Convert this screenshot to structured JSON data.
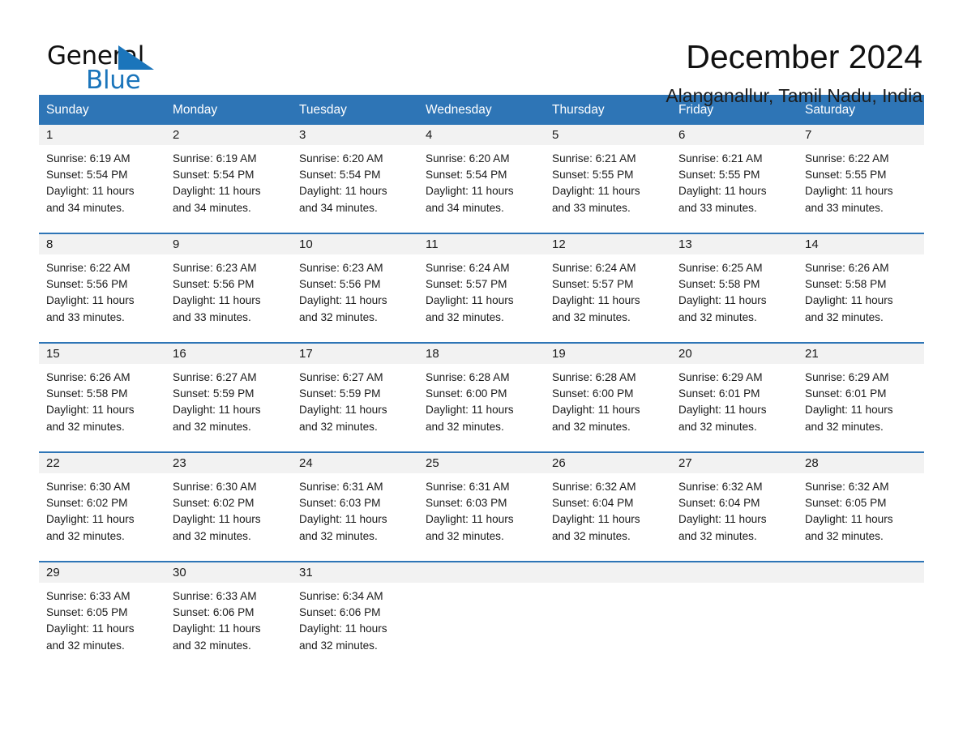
{
  "brand": {
    "name_part1": "General",
    "name_part2": "Blue",
    "triangle_icon": "triangle-icon",
    "accent_color": "#1b75bb"
  },
  "header": {
    "title": "December 2024",
    "subtitle": "Alanganallur, Tamil Nadu, India"
  },
  "colors": {
    "header_bar": "#2e75b6",
    "day_band": "#f2f2f2",
    "week_separator": "#2e75b6",
    "text": "#1a1a1a"
  },
  "calendar": {
    "weekday_headers": [
      "Sunday",
      "Monday",
      "Tuesday",
      "Wednesday",
      "Thursday",
      "Friday",
      "Saturday"
    ],
    "weeks": [
      [
        {
          "day": "1",
          "sunrise": "Sunrise: 6:19 AM",
          "sunset": "Sunset: 5:54 PM",
          "daylight_line1": "Daylight: 11 hours",
          "daylight_line2": "and 34 minutes."
        },
        {
          "day": "2",
          "sunrise": "Sunrise: 6:19 AM",
          "sunset": "Sunset: 5:54 PM",
          "daylight_line1": "Daylight: 11 hours",
          "daylight_line2": "and 34 minutes."
        },
        {
          "day": "3",
          "sunrise": "Sunrise: 6:20 AM",
          "sunset": "Sunset: 5:54 PM",
          "daylight_line1": "Daylight: 11 hours",
          "daylight_line2": "and 34 minutes."
        },
        {
          "day": "4",
          "sunrise": "Sunrise: 6:20 AM",
          "sunset": "Sunset: 5:54 PM",
          "daylight_line1": "Daylight: 11 hours",
          "daylight_line2": "and 34 minutes."
        },
        {
          "day": "5",
          "sunrise": "Sunrise: 6:21 AM",
          "sunset": "Sunset: 5:55 PM",
          "daylight_line1": "Daylight: 11 hours",
          "daylight_line2": "and 33 minutes."
        },
        {
          "day": "6",
          "sunrise": "Sunrise: 6:21 AM",
          "sunset": "Sunset: 5:55 PM",
          "daylight_line1": "Daylight: 11 hours",
          "daylight_line2": "and 33 minutes."
        },
        {
          "day": "7",
          "sunrise": "Sunrise: 6:22 AM",
          "sunset": "Sunset: 5:55 PM",
          "daylight_line1": "Daylight: 11 hours",
          "daylight_line2": "and 33 minutes."
        }
      ],
      [
        {
          "day": "8",
          "sunrise": "Sunrise: 6:22 AM",
          "sunset": "Sunset: 5:56 PM",
          "daylight_line1": "Daylight: 11 hours",
          "daylight_line2": "and 33 minutes."
        },
        {
          "day": "9",
          "sunrise": "Sunrise: 6:23 AM",
          "sunset": "Sunset: 5:56 PM",
          "daylight_line1": "Daylight: 11 hours",
          "daylight_line2": "and 33 minutes."
        },
        {
          "day": "10",
          "sunrise": "Sunrise: 6:23 AM",
          "sunset": "Sunset: 5:56 PM",
          "daylight_line1": "Daylight: 11 hours",
          "daylight_line2": "and 32 minutes."
        },
        {
          "day": "11",
          "sunrise": "Sunrise: 6:24 AM",
          "sunset": "Sunset: 5:57 PM",
          "daylight_line1": "Daylight: 11 hours",
          "daylight_line2": "and 32 minutes."
        },
        {
          "day": "12",
          "sunrise": "Sunrise: 6:24 AM",
          "sunset": "Sunset: 5:57 PM",
          "daylight_line1": "Daylight: 11 hours",
          "daylight_line2": "and 32 minutes."
        },
        {
          "day": "13",
          "sunrise": "Sunrise: 6:25 AM",
          "sunset": "Sunset: 5:58 PM",
          "daylight_line1": "Daylight: 11 hours",
          "daylight_line2": "and 32 minutes."
        },
        {
          "day": "14",
          "sunrise": "Sunrise: 6:26 AM",
          "sunset": "Sunset: 5:58 PM",
          "daylight_line1": "Daylight: 11 hours",
          "daylight_line2": "and 32 minutes."
        }
      ],
      [
        {
          "day": "15",
          "sunrise": "Sunrise: 6:26 AM",
          "sunset": "Sunset: 5:58 PM",
          "daylight_line1": "Daylight: 11 hours",
          "daylight_line2": "and 32 minutes."
        },
        {
          "day": "16",
          "sunrise": "Sunrise: 6:27 AM",
          "sunset": "Sunset: 5:59 PM",
          "daylight_line1": "Daylight: 11 hours",
          "daylight_line2": "and 32 minutes."
        },
        {
          "day": "17",
          "sunrise": "Sunrise: 6:27 AM",
          "sunset": "Sunset: 5:59 PM",
          "daylight_line1": "Daylight: 11 hours",
          "daylight_line2": "and 32 minutes."
        },
        {
          "day": "18",
          "sunrise": "Sunrise: 6:28 AM",
          "sunset": "Sunset: 6:00 PM",
          "daylight_line1": "Daylight: 11 hours",
          "daylight_line2": "and 32 minutes."
        },
        {
          "day": "19",
          "sunrise": "Sunrise: 6:28 AM",
          "sunset": "Sunset: 6:00 PM",
          "daylight_line1": "Daylight: 11 hours",
          "daylight_line2": "and 32 minutes."
        },
        {
          "day": "20",
          "sunrise": "Sunrise: 6:29 AM",
          "sunset": "Sunset: 6:01 PM",
          "daylight_line1": "Daylight: 11 hours",
          "daylight_line2": "and 32 minutes."
        },
        {
          "day": "21",
          "sunrise": "Sunrise: 6:29 AM",
          "sunset": "Sunset: 6:01 PM",
          "daylight_line1": "Daylight: 11 hours",
          "daylight_line2": "and 32 minutes."
        }
      ],
      [
        {
          "day": "22",
          "sunrise": "Sunrise: 6:30 AM",
          "sunset": "Sunset: 6:02 PM",
          "daylight_line1": "Daylight: 11 hours",
          "daylight_line2": "and 32 minutes."
        },
        {
          "day": "23",
          "sunrise": "Sunrise: 6:30 AM",
          "sunset": "Sunset: 6:02 PM",
          "daylight_line1": "Daylight: 11 hours",
          "daylight_line2": "and 32 minutes."
        },
        {
          "day": "24",
          "sunrise": "Sunrise: 6:31 AM",
          "sunset": "Sunset: 6:03 PM",
          "daylight_line1": "Daylight: 11 hours",
          "daylight_line2": "and 32 minutes."
        },
        {
          "day": "25",
          "sunrise": "Sunrise: 6:31 AM",
          "sunset": "Sunset: 6:03 PM",
          "daylight_line1": "Daylight: 11 hours",
          "daylight_line2": "and 32 minutes."
        },
        {
          "day": "26",
          "sunrise": "Sunrise: 6:32 AM",
          "sunset": "Sunset: 6:04 PM",
          "daylight_line1": "Daylight: 11 hours",
          "daylight_line2": "and 32 minutes."
        },
        {
          "day": "27",
          "sunrise": "Sunrise: 6:32 AM",
          "sunset": "Sunset: 6:04 PM",
          "daylight_line1": "Daylight: 11 hours",
          "daylight_line2": "and 32 minutes."
        },
        {
          "day": "28",
          "sunrise": "Sunrise: 6:32 AM",
          "sunset": "Sunset: 6:05 PM",
          "daylight_line1": "Daylight: 11 hours",
          "daylight_line2": "and 32 minutes."
        }
      ],
      [
        {
          "day": "29",
          "sunrise": "Sunrise: 6:33 AM",
          "sunset": "Sunset: 6:05 PM",
          "daylight_line1": "Daylight: 11 hours",
          "daylight_line2": "and 32 minutes."
        },
        {
          "day": "30",
          "sunrise": "Sunrise: 6:33 AM",
          "sunset": "Sunset: 6:06 PM",
          "daylight_line1": "Daylight: 11 hours",
          "daylight_line2": "and 32 minutes."
        },
        {
          "day": "31",
          "sunrise": "Sunrise: 6:34 AM",
          "sunset": "Sunset: 6:06 PM",
          "daylight_line1": "Daylight: 11 hours",
          "daylight_line2": "and 32 minutes."
        },
        {
          "day": "",
          "sunrise": "",
          "sunset": "",
          "daylight_line1": "",
          "daylight_line2": ""
        },
        {
          "day": "",
          "sunrise": "",
          "sunset": "",
          "daylight_line1": "",
          "daylight_line2": ""
        },
        {
          "day": "",
          "sunrise": "",
          "sunset": "",
          "daylight_line1": "",
          "daylight_line2": ""
        },
        {
          "day": "",
          "sunrise": "",
          "sunset": "",
          "daylight_line1": "",
          "daylight_line2": ""
        }
      ]
    ]
  }
}
